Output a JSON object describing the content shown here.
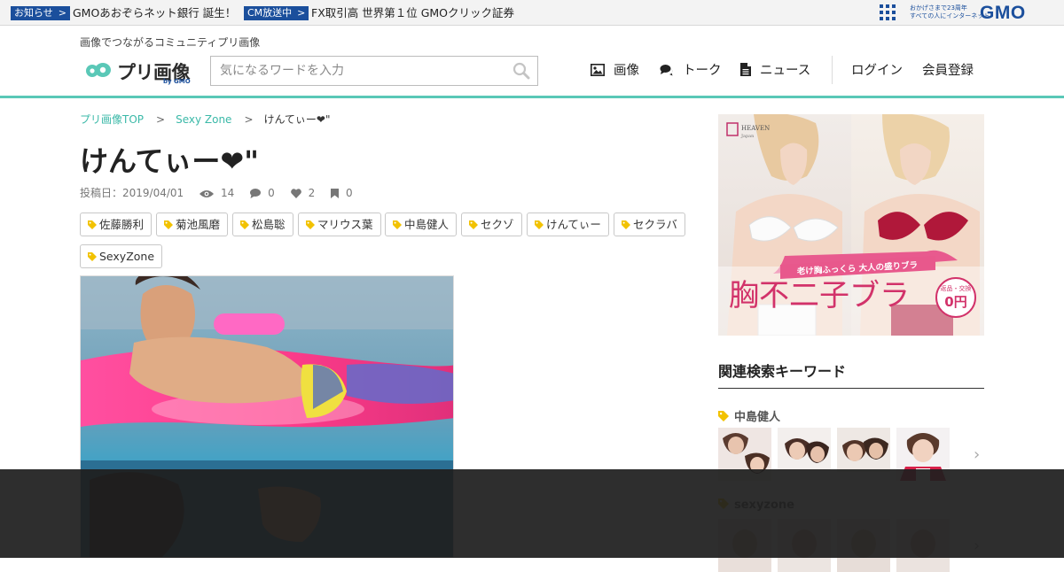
{
  "gmo_bar": {
    "notice_label": "お知らせ",
    "notice_caret": ">",
    "notice_text": "GMOあおぞらネット銀行 誕生！",
    "cm_label": "CM放送中",
    "cm_caret": ">",
    "cm_text": "FX取引高 世界第１位 GMOクリック証券",
    "slogan_line1": "おかげさまで23周年",
    "slogan_line2": "すべての人にインターネット",
    "logo_text": "GMO",
    "brand_color": "#1b4f9c"
  },
  "header": {
    "tagline": "画像でつながるコミュニティプリ画像",
    "logo_text": "プリ画像",
    "logo_by": "by GMO",
    "search_placeholder": "気になるワードを入力",
    "nav": {
      "images": "画像",
      "talk": "トーク",
      "news": "ニュース",
      "login": "ログイン",
      "register": "会員登録"
    },
    "accent_color": "#5ac8b7"
  },
  "breadcrumb": {
    "top": "プリ画像TOP",
    "sep": ">",
    "category": "Sexy Zone",
    "current": "けんてぃー❤︎\""
  },
  "post": {
    "title": "けんてぃー❤︎\"",
    "date_label": "投稿日：2019/04/01",
    "views": "14",
    "comments": "0",
    "likes": "2",
    "saves": "0",
    "tags": [
      "佐藤勝利",
      "菊池風磨",
      "松島聡",
      "マリウス葉",
      "中島健人",
      "セクゾ",
      "けんてぃー",
      "セクラバ",
      "SexyZone"
    ]
  },
  "ad": {
    "brand": "HEAVEN",
    "brand_sub": "Japan",
    "ribbon": "老け胸ふっくら 大人の盛りブラ",
    "headline": "胸不二子ブラ",
    "badge_top": "返品・交換",
    "badge_value": "0円"
  },
  "related": {
    "title": "関連検索キーワード",
    "keywords": [
      {
        "name": "中島健人"
      },
      {
        "name": "sexyzone"
      }
    ],
    "next_arrow": "›"
  }
}
